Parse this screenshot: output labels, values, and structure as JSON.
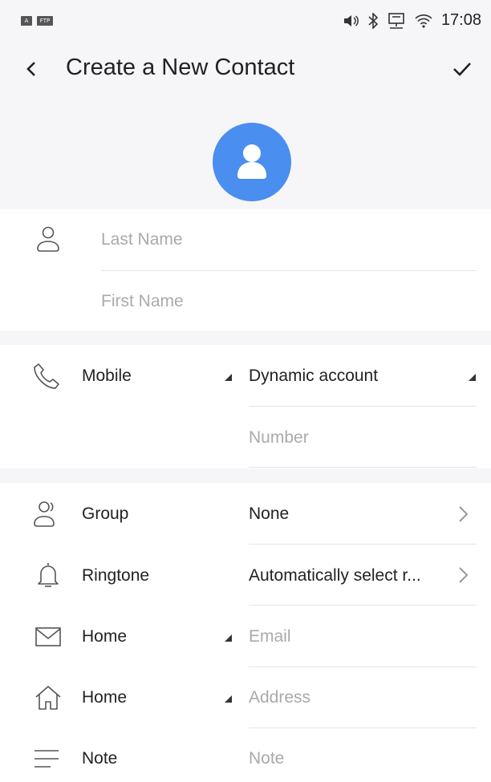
{
  "status_bar": {
    "left_icons": [
      "A",
      "FTP"
    ],
    "right_icons": [
      "volume-icon",
      "bluetooth-icon",
      "network-icon",
      "wifi-icon"
    ],
    "time": "17:08"
  },
  "header": {
    "title": "Create a New Contact",
    "back_icon": "chevron-left-icon",
    "confirm_icon": "check-icon"
  },
  "avatar": {
    "icon": "person-icon",
    "color": "#4a8ef0"
  },
  "name": {
    "last_name_placeholder": "Last Name",
    "first_name_placeholder": "First Name"
  },
  "phone": {
    "type_label": "Mobile",
    "account_value": "Dynamic account",
    "number_placeholder": "Number"
  },
  "group": {
    "label": "Group",
    "value": "None"
  },
  "ringtone": {
    "label": "Ringtone",
    "value": "Automatically select r..."
  },
  "email": {
    "type_label": "Home",
    "placeholder": "Email"
  },
  "address": {
    "type_label": "Home",
    "placeholder": "Address"
  },
  "note": {
    "label": "Note",
    "placeholder": "Note"
  }
}
